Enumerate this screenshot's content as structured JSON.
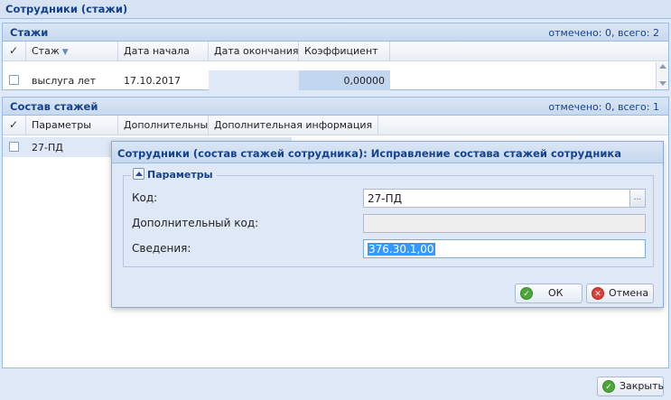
{
  "window": {
    "title": "Сотрудники (стажи)"
  },
  "stazhi_panel": {
    "title": "Стажи",
    "count_text": "отмечено: 0, всего: 2",
    "columns": [
      "Стаж",
      "Дата начала",
      "Дата окончания",
      "Коэффициент"
    ],
    "rows": [
      {
        "stazh": "выслуга лет",
        "start": "17.10.2017",
        "end": "",
        "coef": "0,00000"
      }
    ]
  },
  "sostav_panel": {
    "title": "Состав стажей",
    "count_text": "отмечено: 0, всего: 1",
    "columns": [
      "Параметры",
      "Дополнительные п",
      "Дополнительная информация"
    ],
    "rows": [
      {
        "param": "27-ПД"
      }
    ]
  },
  "dialog": {
    "title": "Сотрудники (состав стажей сотрудника): Исправление состава стажей сотрудника",
    "fieldset_title": "Параметры",
    "fields": {
      "code_label": "Код:",
      "code_value": "27-ПД",
      "trigger_text": "...",
      "extra_code_label": "Дополнительный код:",
      "extra_code_value": "",
      "info_label": "Сведения:",
      "info_value": "376.30.1,00"
    },
    "ok_label": "ОК",
    "cancel_label": "Отмена"
  },
  "footer": {
    "close_label": "Закрыть"
  },
  "icons": {
    "checkmark": "✓",
    "ok_icon": "check-circle-icon",
    "cancel_icon": "x-circle-icon"
  }
}
